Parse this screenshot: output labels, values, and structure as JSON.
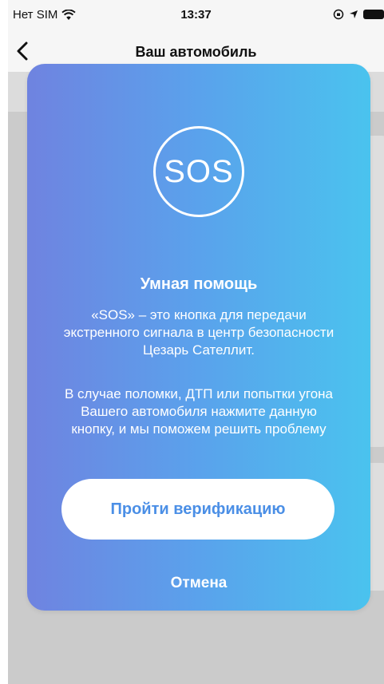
{
  "status_bar": {
    "carrier": "Нет SIM",
    "time": "13:37"
  },
  "nav": {
    "title": "Ваш автомобиль"
  },
  "modal": {
    "badge": "SOS",
    "title": "Умная помощь",
    "description_1": "«SOS» – это кнопка для передачи экстренного сигнала в центр безопасности Цезарь Сателлит.",
    "description_2": "В случае поломки, ДТП или попытки угона Вашего автомобиля нажмите данную кнопку, и мы поможем решить проблему",
    "primary_button": "Пройти верификацию",
    "cancel_button": "Отмена"
  },
  "colors": {
    "gradient_start": "#6f83e0",
    "gradient_end": "#4ac3ee",
    "button_text": "#4b8fe6"
  }
}
